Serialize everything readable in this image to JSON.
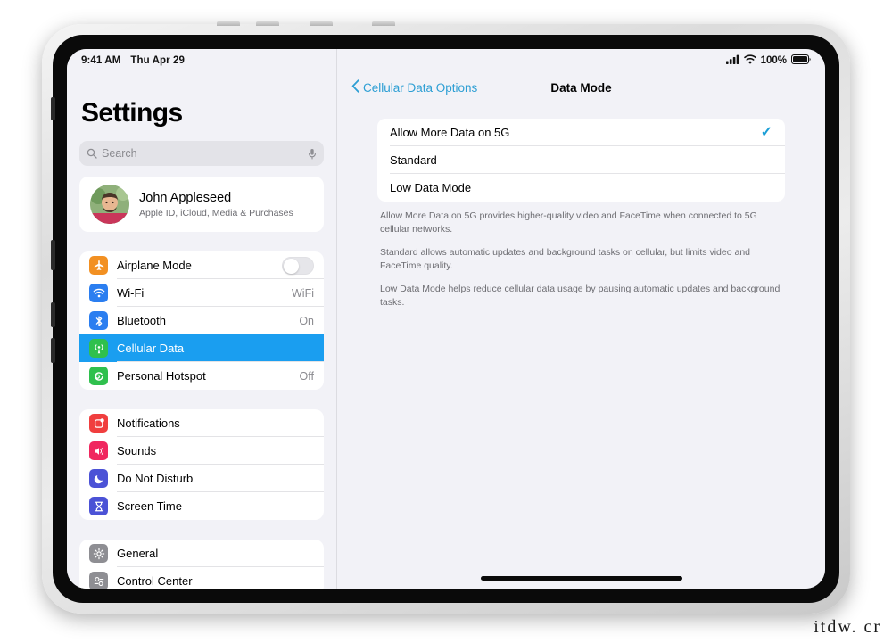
{
  "watermark": "itdw. cr",
  "status_bar": {
    "time": "9:41 AM",
    "date": "Thu Apr 29",
    "battery_percent": "100%",
    "cellular_icon": "cellular-signal-icon",
    "wifi_icon": "wifi-icon",
    "battery_icon": "battery-full-icon"
  },
  "sidebar": {
    "title": "Settings",
    "search": {
      "placeholder": "Search",
      "value": "",
      "search_icon": "search-icon",
      "mic_icon": "microphone-icon"
    },
    "profile": {
      "name": "John Appleseed",
      "subtitle": "Apple ID, iCloud, Media & Purchases",
      "avatar_icon": "avatar"
    },
    "groups": [
      {
        "items": [
          {
            "label": "Airplane Mode",
            "value": "",
            "icon": "airplane-icon",
            "color": "#f29022",
            "control": "toggle",
            "toggle_on": false,
            "selected": false
          },
          {
            "label": "Wi-Fi",
            "value": "WiFi",
            "icon": "wifi-icon",
            "color": "#2b7ef0",
            "control": "value",
            "selected": false
          },
          {
            "label": "Bluetooth",
            "value": "On",
            "icon": "bluetooth-icon",
            "color": "#2b7ef0",
            "control": "value",
            "selected": false
          },
          {
            "label": "Cellular Data",
            "value": "",
            "icon": "cellular-antenna-icon",
            "color": "#2fc04d",
            "control": "none",
            "selected": true
          },
          {
            "label": "Personal Hotspot",
            "value": "Off",
            "icon": "hotspot-icon",
            "color": "#2fc04d",
            "control": "value",
            "selected": false
          }
        ]
      },
      {
        "items": [
          {
            "label": "Notifications",
            "value": "",
            "icon": "notifications-icon",
            "color": "#f03e3e",
            "control": "none",
            "selected": false
          },
          {
            "label": "Sounds",
            "value": "",
            "icon": "sounds-icon",
            "color": "#f0275f",
            "control": "none",
            "selected": false
          },
          {
            "label": "Do Not Disturb",
            "value": "",
            "icon": "moon-icon",
            "color": "#4b52d6",
            "control": "none",
            "selected": false
          },
          {
            "label": "Screen Time",
            "value": "",
            "icon": "hourglass-icon",
            "color": "#4b52d6",
            "control": "none",
            "selected": false
          }
        ]
      },
      {
        "items": [
          {
            "label": "General",
            "value": "",
            "icon": "gear-icon",
            "color": "#8e8e93",
            "control": "none",
            "selected": false
          },
          {
            "label": "Control Center",
            "value": "",
            "icon": "control-center-icon",
            "color": "#8e8e93",
            "control": "none",
            "selected": false
          }
        ]
      }
    ]
  },
  "main": {
    "back_label": "Cellular Data Options",
    "back_icon": "chevron-left-icon",
    "title": "Data Mode",
    "options": [
      {
        "label": "Allow More Data on 5G",
        "checked": true
      },
      {
        "label": "Standard",
        "checked": false
      },
      {
        "label": "Low Data Mode",
        "checked": false
      }
    ],
    "check_icon": "checkmark-icon",
    "footnotes": [
      "Allow More Data on 5G provides higher-quality video and FaceTime when connected to 5G cellular networks.",
      "Standard allows automatic updates and background tasks on cellular, but limits video and FaceTime quality.",
      "Low Data Mode helps reduce cellular data usage by pausing automatic updates and background tasks."
    ]
  },
  "colors": {
    "accent_blue": "#1a9ef0",
    "link_blue": "#2e9fd4",
    "check_blue": "#1a9ed6",
    "panel_bg": "#f2f2f7",
    "card_bg": "#ffffff"
  }
}
